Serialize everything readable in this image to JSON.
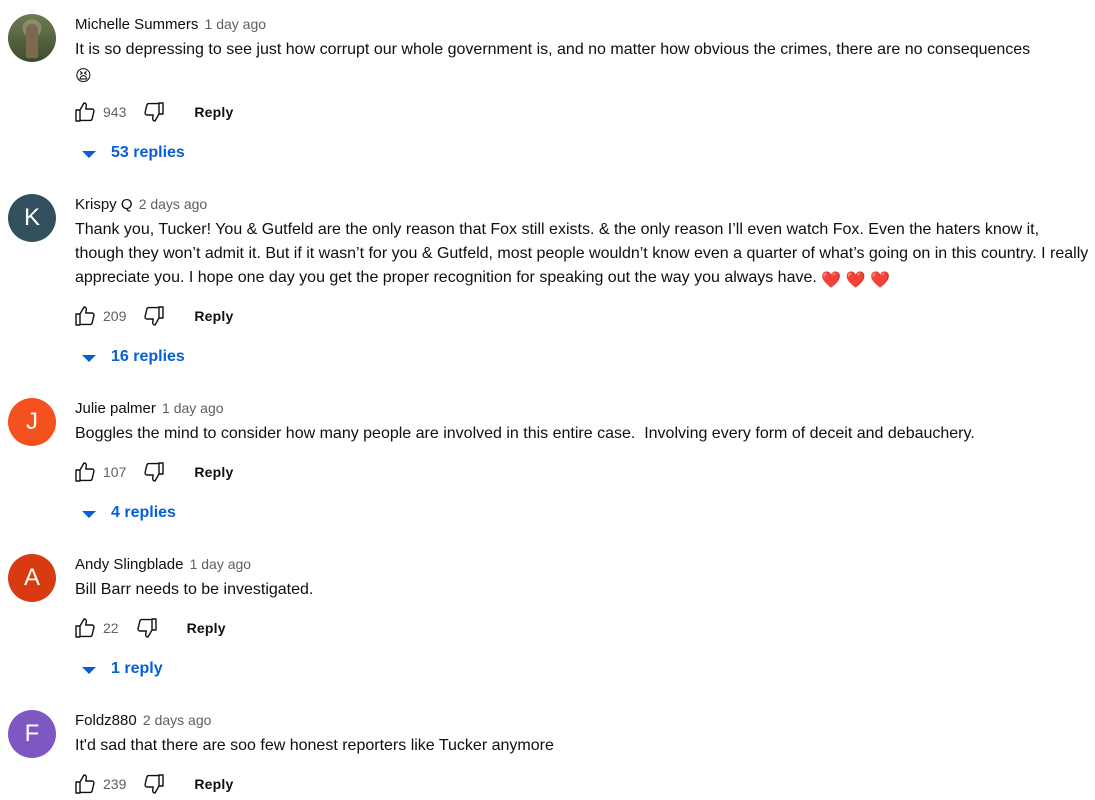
{
  "comments": [
    {
      "author": "Michelle Summers",
      "time": "1 day ago",
      "text": "It is so depressing to see just how corrupt our whole government is, and no matter how obvious the crimes, there are no consequences",
      "emoji": "😫",
      "likes": "943",
      "reply_label": "Reply",
      "replies": "53 replies",
      "avatar": {
        "type": "photo",
        "letter": ""
      }
    },
    {
      "author": "Krispy Q",
      "time": "2 days ago",
      "text": "Thank you, Tucker! You & Gutfeld are the only reason that Fox still exists. & the only reason I’ll even watch Fox. Even the haters know it, though they won’t admit it. But if it wasn’t for you & Gutfeld, most people wouldn’t know even a quarter of what’s going on in this country. I really appreciate you. I hope one day you get the proper recognition for speaking out the way you always have.",
      "emoji": "❤️ ❤️ ❤️",
      "likes": "209",
      "reply_label": "Reply",
      "replies": "16 replies",
      "avatar": {
        "type": "letter",
        "letter": "K",
        "color": "#33505e"
      }
    },
    {
      "author": "Julie palmer",
      "time": "1 day ago",
      "text": "Boggles the mind to consider how many people are involved in this entire case.  Involving every form of deceit and debauchery.",
      "emoji": "",
      "likes": "107",
      "reply_label": "Reply",
      "replies": "4 replies",
      "avatar": {
        "type": "letter",
        "letter": "J",
        "color": "#f4511e"
      }
    },
    {
      "author": "Andy Slingblade",
      "time": "1 day ago",
      "text": "Bill Barr needs to be investigated.",
      "emoji": "",
      "likes": "22",
      "reply_label": "Reply",
      "replies": "1 reply",
      "avatar": {
        "type": "letter",
        "letter": "A",
        "color": "#d83a12"
      }
    },
    {
      "author": "Foldz880",
      "time": "2 days ago",
      "text": "It'd sad that there are soo few honest reporters like Tucker anymore",
      "emoji": "",
      "likes": "239",
      "reply_label": "Reply",
      "replies": "",
      "avatar": {
        "type": "letter",
        "letter": "F",
        "color": "#7e57c2"
      }
    }
  ],
  "icons": {
    "like": "thumbs-up-icon",
    "dislike": "thumbs-down-icon",
    "expand": "caret-down-icon"
  },
  "colors": {
    "link": "#065fd4",
    "meta": "#606060",
    "text": "#0f0f0f"
  }
}
